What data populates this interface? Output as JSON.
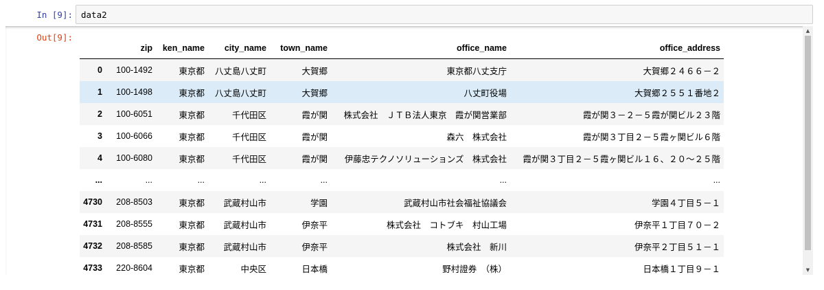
{
  "cell": {
    "in_prompt": "In [9]:",
    "code": "data2",
    "out_prompt": "Out[9]:"
  },
  "table": {
    "columns": [
      "",
      "zip",
      "ken_name",
      "city_name",
      "town_name",
      "office_name",
      "office_address"
    ],
    "rows": [
      {
        "index": "0",
        "cells": [
          "100-1492",
          "東京都",
          "八丈島八丈町",
          "大賀郷",
          "東京都八丈支庁",
          "大賀郷２４６６－２"
        ]
      },
      {
        "index": "1",
        "cells": [
          "100-1498",
          "東京都",
          "八丈島八丈町",
          "大賀郷",
          "八丈町役場",
          "大賀郷２５５１番地２"
        ]
      },
      {
        "index": "2",
        "cells": [
          "100-6051",
          "東京都",
          "千代田区",
          "霞が関",
          "株式会社　ＪＴＢ法人東京　霞が関営業部",
          "霞が関３－２－５霞が関ビル２３階"
        ]
      },
      {
        "index": "3",
        "cells": [
          "100-6066",
          "東京都",
          "千代田区",
          "霞が関",
          "森六　株式会社",
          "霞が関３丁目２－５霞ヶ関ビル６階"
        ]
      },
      {
        "index": "4",
        "cells": [
          "100-6080",
          "東京都",
          "千代田区",
          "霞が関",
          "伊藤忠テクノソリューションズ　株式会社",
          "霞が関３丁目２－５霞ヶ関ビル１６、２０～２５階"
        ]
      },
      {
        "index": "...",
        "cells": [
          "...",
          "...",
          "...",
          "...",
          "...",
          "..."
        ]
      },
      {
        "index": "4730",
        "cells": [
          "208-8503",
          "東京都",
          "武蔵村山市",
          "学園",
          "武蔵村山市社会福祉協議会",
          "学園４丁目５－１"
        ]
      },
      {
        "index": "4731",
        "cells": [
          "208-8555",
          "東京都",
          "武蔵村山市",
          "伊奈平",
          "株式会社　コトブキ　村山工場",
          "伊奈平１丁目７０－２"
        ]
      },
      {
        "index": "4732",
        "cells": [
          "208-8585",
          "東京都",
          "武蔵村山市",
          "伊奈平",
          "株式会社　新川",
          "伊奈平２丁目５１－１"
        ]
      },
      {
        "index": "4733",
        "cells": [
          "220-8604",
          "東京都",
          "中央区",
          "日本橋",
          "野村證券　（株）",
          "日本橋１丁目９－１"
        ]
      }
    ]
  },
  "icons": {
    "scroll_up": "chevron-up-icon",
    "scroll_down": "chevron-down-icon"
  }
}
